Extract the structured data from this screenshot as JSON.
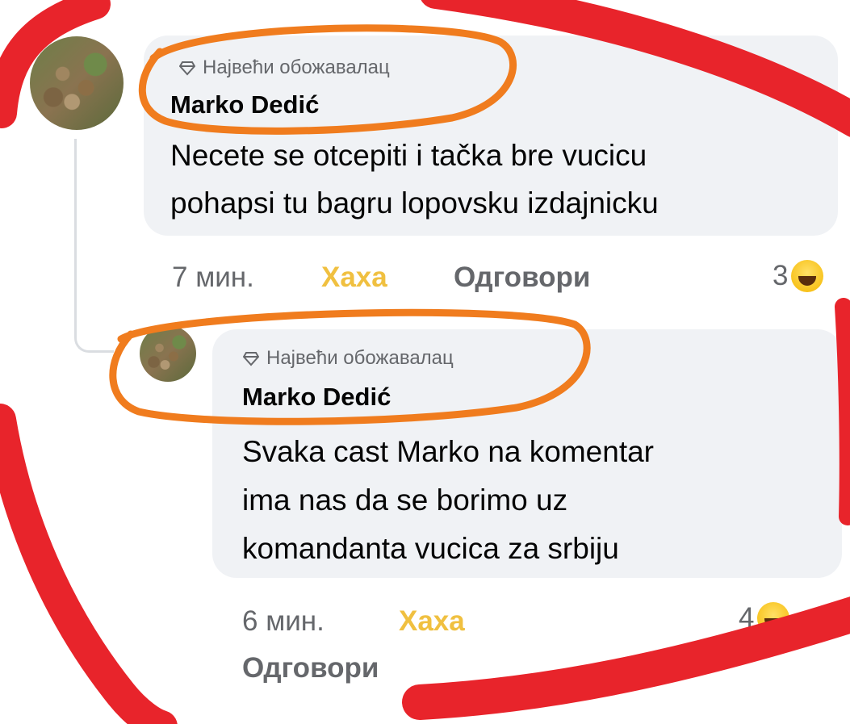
{
  "comments": [
    {
      "badge": "Највећи обожавалац",
      "author": "Marko Dedić",
      "lines": [
        "Necete se otcepiti i tačka bre vucicu",
        "pohapsi tu bagru lopovsku izdajnicku"
      ],
      "time": "7 мин.",
      "reaction_label": "Хаха",
      "reply_label": "Одговори",
      "reaction_count": "3"
    },
    {
      "badge": "Највећи обожавалац",
      "author": "Marko Dedić",
      "lines": [
        "Svaka cast Marko na komentar",
        "ima nas da se borimo uz",
        "komandanta vucica za srbiju"
      ],
      "time": "6 мин.",
      "reaction_label": "Хаха",
      "reply_label": "Одговори",
      "reaction_count": "4"
    }
  ],
  "icons": {
    "badge": "diamond-icon",
    "reaction": "haha-emoji-icon"
  },
  "colors": {
    "annotation_orange": "#f07c1e",
    "annotation_red": "#e8242b",
    "haha": "#f0c040"
  }
}
